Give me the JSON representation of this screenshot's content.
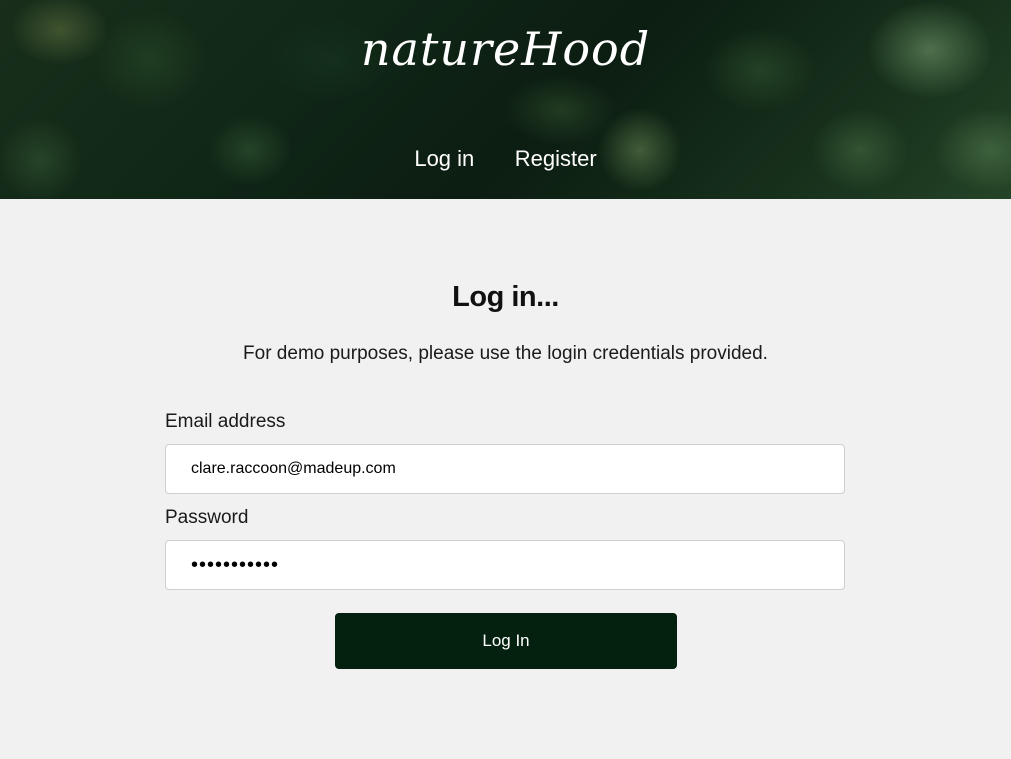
{
  "brand": {
    "logo_text": "natureHood"
  },
  "nav": {
    "login_label": "Log in",
    "register_label": "Register"
  },
  "main": {
    "heading": "Log in...",
    "subtitle": "For demo purposes, please use the login credentials provided."
  },
  "form": {
    "email_label": "Email address",
    "email_value": "clare.raccoon@madeup.com",
    "password_label": "Password",
    "password_value": "password123",
    "submit_label": "Log In"
  },
  "colors": {
    "page_background": "#f1f1f1",
    "button_background": "#04200f",
    "header_text": "#ffffff"
  }
}
